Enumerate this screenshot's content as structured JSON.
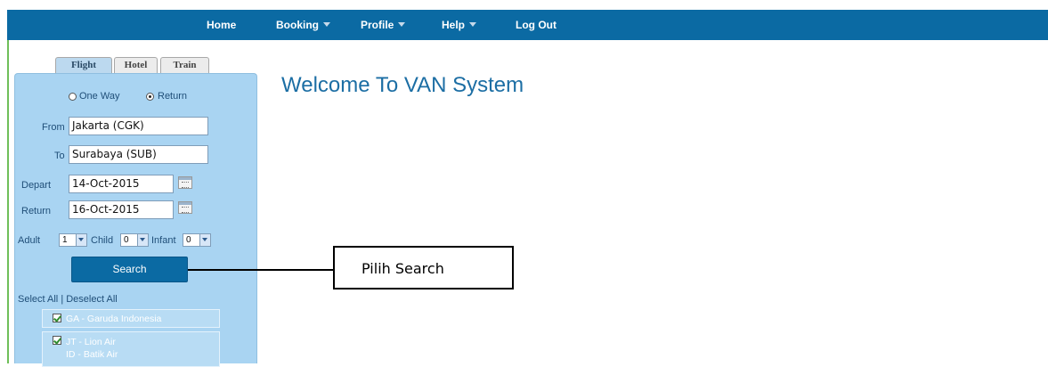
{
  "nav": {
    "items": [
      {
        "label": "Home",
        "dropdown": false
      },
      {
        "label": "Booking",
        "dropdown": true
      },
      {
        "label": "Profile",
        "dropdown": true
      },
      {
        "label": "Help",
        "dropdown": true
      },
      {
        "label": "Log Out",
        "dropdown": false
      }
    ]
  },
  "search_panel": {
    "tabs": [
      {
        "label": "Flight",
        "active": true
      },
      {
        "label": "Hotel",
        "active": false
      },
      {
        "label": "Train",
        "active": false
      }
    ],
    "trip_type": {
      "options": [
        "One Way",
        "Return"
      ],
      "selected": "Return"
    },
    "from": {
      "label": "From",
      "value": "Jakarta (CGK)"
    },
    "to": {
      "label": "To",
      "value": "Surabaya (SUB)"
    },
    "depart": {
      "label": "Depart",
      "value": "14-Oct-2015"
    },
    "return_date": {
      "label": "Return",
      "value": "16-Oct-2015"
    },
    "passengers": {
      "adult": {
        "label": "Adult",
        "value": "1"
      },
      "child": {
        "label": "Child",
        "value": "0"
      },
      "infant": {
        "label": "Infant",
        "value": "0"
      }
    },
    "search_label": "Search",
    "select_all": "Select All",
    "separator": "|",
    "deselect_all": "Deselect All",
    "airlines": [
      {
        "checked": true,
        "lines": [
          "GA  - Garuda Indonesia"
        ]
      },
      {
        "checked": true,
        "lines": [
          "JT  - Lion Air",
          "ID  - Batik Air"
        ]
      }
    ]
  },
  "main": {
    "welcome": "Welcome To VAN System"
  },
  "annotation": {
    "text": "Pilih Search"
  },
  "colors": {
    "nav_bg": "#0b6aa3",
    "panel_bg": "#a9d4f2",
    "title": "#1c6ea4"
  }
}
